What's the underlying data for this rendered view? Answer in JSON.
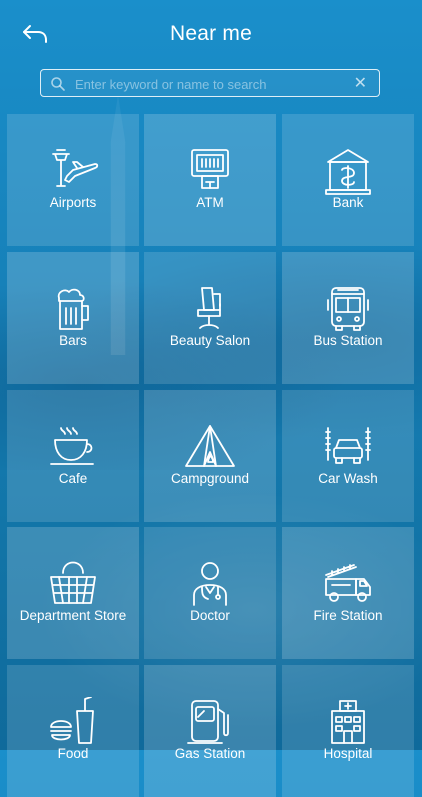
{
  "header": {
    "title": "Near me"
  },
  "search": {
    "placeholder": "Enter keyword or name to search"
  },
  "categories": [
    {
      "label": "Airports",
      "icon": "airport-icon"
    },
    {
      "label": "ATM",
      "icon": "atm-icon"
    },
    {
      "label": "Bank",
      "icon": "bank-icon"
    },
    {
      "label": "Bars",
      "icon": "beer-icon"
    },
    {
      "label": "Beauty Salon",
      "icon": "salon-chair-icon"
    },
    {
      "label": "Bus Station",
      "icon": "bus-icon"
    },
    {
      "label": "Cafe",
      "icon": "coffee-cup-icon"
    },
    {
      "label": "Campground",
      "icon": "tent-icon"
    },
    {
      "label": "Car Wash",
      "icon": "car-wash-icon"
    },
    {
      "label": "Department Store",
      "icon": "shopping-basket-icon"
    },
    {
      "label": "Doctor",
      "icon": "doctor-icon"
    },
    {
      "label": "Fire Station",
      "icon": "fire-truck-icon"
    },
    {
      "label": "Food",
      "icon": "fast-food-icon"
    },
    {
      "label": "Gas Station",
      "icon": "fuel-pump-icon"
    },
    {
      "label": "Hospital",
      "icon": "hospital-icon"
    }
  ]
}
